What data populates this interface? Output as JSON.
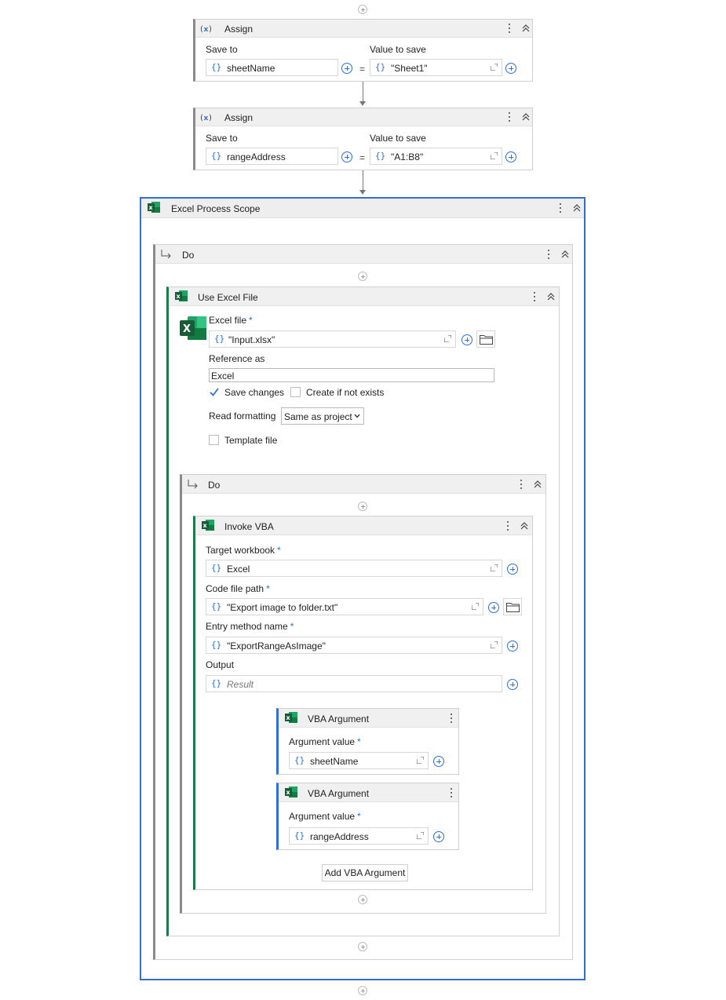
{
  "assign1": {
    "title": "Assign",
    "save_to_label": "Save to",
    "value_label": "Value to save",
    "save_to_value": "sheetName",
    "value_to_save": "\"Sheet1\"",
    "brace": "{}",
    "eq": "="
  },
  "assign2": {
    "title": "Assign",
    "save_to_label": "Save to",
    "value_label": "Value to save",
    "save_to_value": "rangeAddress",
    "value_to_save": "\"A1:B8\"",
    "brace": "{}",
    "eq": "="
  },
  "scope": {
    "title": "Excel Process Scope"
  },
  "do1": {
    "title": "Do"
  },
  "use_excel": {
    "title": "Use Excel File",
    "excel_file_label": "Excel file",
    "required": "*",
    "excel_file_value": "\"Input.xlsx\"",
    "reference_label": "Reference as",
    "reference_value": "Excel",
    "save_changes_label": "Save changes",
    "create_label": "Create if not exists",
    "read_formatting_label": "Read formatting",
    "read_formatting_value": "Same as project",
    "template_label": "Template file",
    "brace": "{}"
  },
  "do2": {
    "title": "Do"
  },
  "invoke_vba": {
    "title": "Invoke VBA",
    "target_label": "Target workbook",
    "target_value": "Excel",
    "code_label": "Code file path",
    "code_value": "\"Export image to folder.txt\"",
    "entry_label": "Entry method name",
    "entry_value": "\"ExportRangeAsImage\"",
    "output_label": "Output",
    "output_placeholder": "Result",
    "required": "*",
    "brace": "{}",
    "add_arg_label": "Add VBA Argument"
  },
  "vba_arg1": {
    "title": "VBA Argument",
    "arg_label": "Argument value",
    "arg_value": "sheetName",
    "required": "*",
    "brace": "{}"
  },
  "vba_arg2": {
    "title": "VBA Argument",
    "arg_label": "Argument value",
    "arg_value": "rangeAddress",
    "required": "*",
    "brace": "{}"
  },
  "icons": {
    "assign": "variable-assign-icon",
    "excel": "excel-icon",
    "do": "do-arrow-icon",
    "kebab": "more-vertical-icon",
    "collapse": "collapse-chevrons-icon",
    "add": "add-circle-icon",
    "expand": "expand-editor-icon",
    "folder": "folder-icon"
  },
  "colors": {
    "accent_blue": "#2f6fd6",
    "excel_green": "#1d7a4a",
    "header_gray": "#f0f0f0"
  }
}
